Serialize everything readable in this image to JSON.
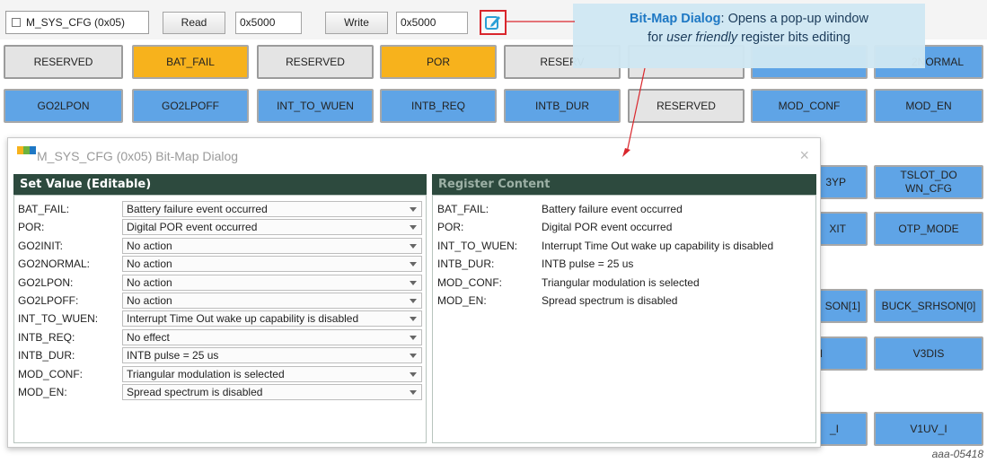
{
  "toolbar": {
    "register": "M_SYS_CFG (0x05)",
    "read_label": "Read",
    "read_value": "0x5000",
    "write_label": "Write",
    "write_value": "0x5000",
    "bitmap_icon": "edit-icon",
    "bitmap_highlight_color": "#d9262c"
  },
  "callout": {
    "bold": "Bit-Map Dialog",
    "text1": ": Opens a pop-up window",
    "text2_pre": "for ",
    "text2_italic": "user friendly",
    "text2_post": " register bits editing"
  },
  "bits": {
    "row1": [
      "RESERVED",
      "BAT_FAIL",
      "RESERVED",
      "POR",
      "RESERV",
      "2NORMAL"
    ],
    "row2": [
      "GO2LPON",
      "GO2LPOFF",
      "INT_TO_WUEN",
      "INTB_REQ",
      "INTB_DUR",
      "RESERVED",
      "MOD_CONF",
      "MOD_EN"
    ],
    "side": [
      "3YP",
      "TSLOT_DO WN_CFG",
      "XIT",
      "OTP_MODE",
      "SON[1]",
      "BUCK_SRHSON[0]",
      "N",
      "V3DIS",
      "_I",
      "V1UV_I"
    ]
  },
  "colors": {
    "orange": "#f7b21c",
    "blue": "#5fa4e6",
    "gray": "#e4e4e4",
    "panel_header": "#2d4a3e"
  },
  "dialog": {
    "title": "M_SYS_CFG (0x05) Bit-Map Dialog",
    "close": "×",
    "set_value_header": "Set Value (Editable)",
    "register_content_header": "Register Content",
    "fields": [
      {
        "label": "BAT_FAIL:",
        "value": "Battery failure event occurred"
      },
      {
        "label": "POR:",
        "value": "Digital POR event occurred"
      },
      {
        "label": "GO2INIT:",
        "value": "No action"
      },
      {
        "label": "GO2NORMAL:",
        "value": "No action"
      },
      {
        "label": "GO2LPON:",
        "value": "No action"
      },
      {
        "label": "GO2LPOFF:",
        "value": "No action"
      },
      {
        "label": "INT_TO_WUEN:",
        "value": "Interrupt Time Out wake up capability is disabled"
      },
      {
        "label": "INTB_REQ:",
        "value": "No effect"
      },
      {
        "label": "INTB_DUR:",
        "value": "INTB pulse = 25 us"
      },
      {
        "label": "MOD_CONF:",
        "value": "Triangular modulation is selected"
      },
      {
        "label": "MOD_EN:",
        "value": "Spread spectrum is disabled"
      }
    ],
    "register_content": [
      {
        "label": "BAT_FAIL:",
        "value": "Battery failure event occurred"
      },
      {
        "label": "POR:",
        "value": "Digital POR event occurred"
      },
      {
        "label": "INT_TO_WUEN:",
        "value": "Interrupt Time Out wake up capability is disabled"
      },
      {
        "label": "INTB_DUR:",
        "value": "INTB pulse = 25 us"
      },
      {
        "label": "MOD_CONF:",
        "value": "Triangular modulation is selected"
      },
      {
        "label": "MOD_EN:",
        "value": "Spread spectrum is disabled"
      }
    ]
  },
  "figure_id": "aaa-05418"
}
